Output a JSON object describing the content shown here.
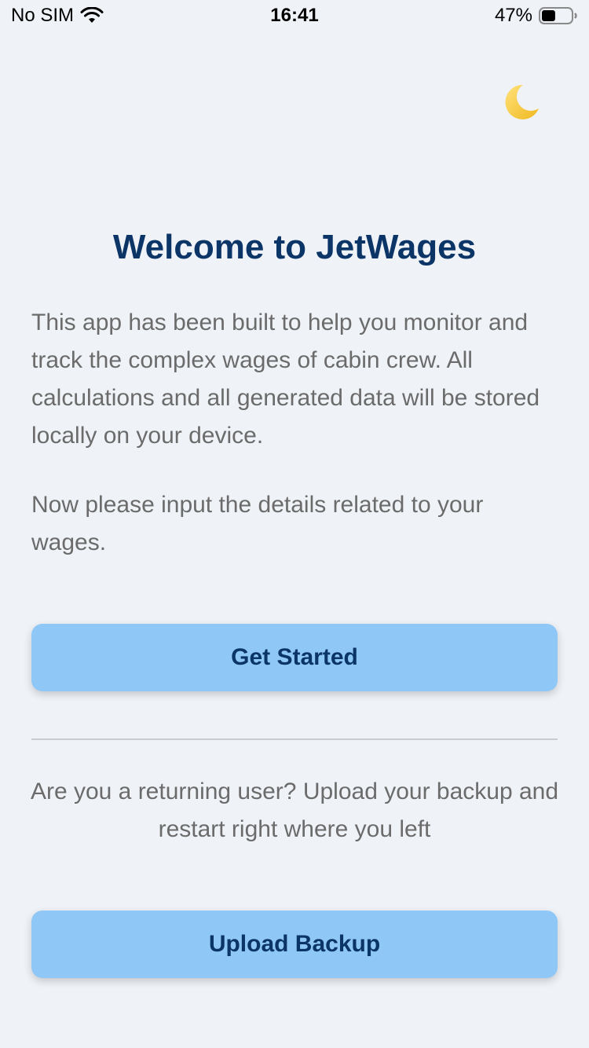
{
  "status_bar": {
    "carrier": "No SIM",
    "time": "16:41",
    "battery_percent": "47%",
    "battery_level": 0.47,
    "wifi_icon": "wifi-icon",
    "battery_icon": "battery-icon"
  },
  "theme_toggle": {
    "icon": "crescent-moon-icon",
    "glyph": "🌙"
  },
  "welcome": {
    "title": "Welcome to JetWages",
    "intro": "This app has been built to help you monitor and track the complex wages of cabin crew. All calculations and all generated data will be stored locally on your device.",
    "instruction": "Now please input the details related to your wages."
  },
  "actions": {
    "get_started_label": "Get Started",
    "returning_text": "Are you a returning user? Upload your backup and restart right where you left",
    "upload_backup_label": "Upload Backup"
  },
  "colors": {
    "background": "#eff2f7",
    "primary_text": "#0b3467",
    "body_text": "#6b6b6b",
    "button_bg": "#8fc8f7"
  }
}
